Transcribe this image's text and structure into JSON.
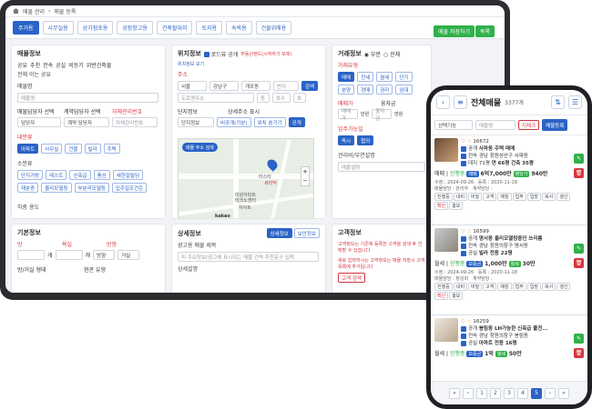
{
  "breadcrumb": {
    "parent": "매물 관리",
    "current": "매물 등록"
  },
  "tabs": [
    "주거용",
    "사무실용",
    "상가점포용",
    "공장창고용",
    "건축할대지",
    "토지용",
    "숙박용",
    "건물위매용"
  ],
  "toolbar": {
    "save": "매물 저장하기",
    "list": "목록"
  },
  "sale_info": {
    "title": "매물정보",
    "types": [
      "공유",
      "추천",
      "전속",
      "공실",
      "비등기",
      "위반건축물"
    ],
    "type2": "전체 이는 공유",
    "name_label": "매물명",
    "name_placeholder": "매물명",
    "agent_label": "매물담당자 선택",
    "contract_label": "계약담당자 선택",
    "cert_label": "자체관리번호",
    "agent_value": "담당자",
    "contract_value": "계약 담당자",
    "cert_placeholder": "자체관리번호",
    "big_label": "대분류",
    "big": [
      "아파트",
      "사무실",
      "건물",
      "빌라",
      "주택"
    ],
    "small_label": "소분류",
    "small": [
      "단지가방",
      "테스트",
      "신축급",
      "풍선",
      "새한밀빌딩",
      "재분증",
      "올리모델링",
      "부분리모델링",
      "입주일조건은"
    ],
    "usage_label": "하층 용도"
  },
  "location": {
    "title": "위치정보",
    "road_check": "로드뷰 공개",
    "note": "부동산랜드(시작하기 포레)",
    "view": "위치정보 보기",
    "addr_label": "주소",
    "city": "서울",
    "district": "강남구",
    "dong": "개포동",
    "jibun": "번지",
    "search": "검색",
    "road_placeholder": "도로명주소",
    "dong2": "동",
    "ho": "호수",
    "ho2": "호",
    "complex_label": "단지정보",
    "detail_label": "상세주소 표시",
    "complex_value": "단지정보",
    "d1": "비공개(기본)",
    "d2": "위치 숨기기",
    "d3": "공개",
    "map_marker": "매물 주소 검색",
    "map_label1": "타스타",
    "map_label2": "세라믹",
    "map_label3": "대원아파트",
    "map_label4": "태크노센터",
    "map_label5": "하야트",
    "kakao": "kakao"
  },
  "price": {
    "title": "거래정보",
    "opt1": "부분",
    "opt2": "전체",
    "kind_label": "거래유형",
    "kinds": [
      "매매",
      "전세",
      "월세",
      "단기",
      "분양",
      "경매",
      "권리",
      "임대"
    ],
    "pay_label": "매매가",
    "pay2_label": "융자금",
    "pay_ph": "매매가",
    "pay_unit": "만원",
    "loan_ph": "융자금",
    "loan_unit": "만원",
    "move_label": "입주가능일",
    "move": [
      "즉시",
      "협의"
    ],
    "mgmt_label": "관리비/부연설명",
    "mgmt_ph": "매물설명"
  },
  "basic": {
    "title": "기본정보",
    "room": "방",
    "bath": "욕실",
    "dir": "방향",
    "room_unit": "개",
    "bath_unit": "개",
    "dir_value": "방향",
    "dir_unit": "거실",
    "floor_label": "방/거실 형태",
    "heat_label": "현관 유형"
  },
  "detail": {
    "title": "상세정보",
    "t1": "상세정보",
    "t2": "보안정보",
    "ad_label": "광고용 매물 제목",
    "ad_ph": "미 주요정보(광고에 표시되는 매물 간략 추천문구 입력",
    "desc_label": "상세설명"
  },
  "client": {
    "title": "고객정보",
    "n1": "고객정보는 기존에 등록한 고객을 검색 후 선택할 수 있습니다",
    "n2": "새로 입력하시는 고객정보는 매물 저장시 고객목록에 추가됩니다",
    "btn": "고객 검색"
  },
  "mobile": {
    "title": "전체매물",
    "count": "3377개",
    "filter": "선택기능",
    "search_ph": "매물명",
    "reset": "지체크",
    "add": "매물등록",
    "listings": [
      {
        "id": "16672",
        "public": "공개",
        "name": "사파동 주택 매매",
        "sale": "전속",
        "addr": "경남 창원성산구 사파동",
        "meta1": "대지 71평",
        "meta2": "연 66평",
        "meta3": "건축 35평",
        "dtype": "매매",
        "status": "진행중",
        "price1": "매매",
        "price": "6억7,000만",
        "pnote": "평당가",
        "pval": "940만",
        "date1": "수정 : 2024-09-26",
        "date2": "등록 : 2020-11-18",
        "owner": "매물담당 : 관리자",
        "cont": "계약담당 :"
      },
      {
        "id": "16599",
        "public": "공개",
        "name": "명서동 올리모델링중인 쓰리룸",
        "sale": "전속",
        "addr": "경남 창원의창구 명서동",
        "meta1": "공실",
        "meta2": "빌라",
        "meta3": "전용 22평",
        "dtype": "월세",
        "status": "진행중",
        "price1": "보증금",
        "price": "1,000만",
        "pnote": "월세",
        "pval": "30만",
        "date1": "수정 : 2024-09-26",
        "date2": "등록 : 2020-11-18",
        "owner": "매물담당 : 정성희",
        "cont": "계약담당 :"
      },
      {
        "id": "16259",
        "public": "공개",
        "name": "봉림동 LH가능한 신축급 풀전...",
        "sale": "전속",
        "addr": "경남 창원의창구 봉림동",
        "meta1": "공실",
        "meta2": "아파트",
        "meta3": "전용 16평",
        "dtype": "월세",
        "status": "진행중",
        "price1": "보증금",
        "price": "1억",
        "pnote": "월세",
        "pval": "50만",
        "date1": "",
        "date2": "",
        "owner": "",
        "cont": ""
      }
    ],
    "actions": [
      "진행중",
      "내비",
      "비밀",
      "고객",
      "매칭",
      "업무",
      "입장",
      "복사",
      "갱신",
      "확인",
      "홍보"
    ],
    "pages": [
      "«",
      "‹",
      "1",
      "2",
      "3",
      "4",
      "5",
      "›",
      "»"
    ],
    "current_page": "5"
  }
}
